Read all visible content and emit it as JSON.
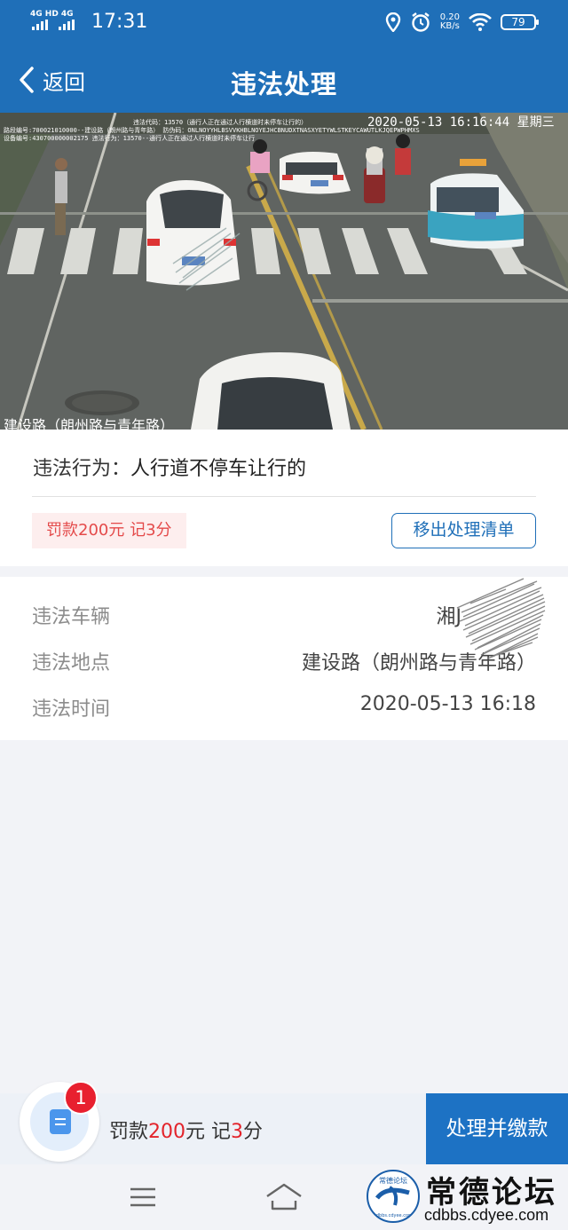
{
  "status_bar": {
    "network_top": "4G HD 4G",
    "time": "17:31",
    "speed_value": "0.20",
    "speed_unit": "KB/s",
    "battery": "79",
    "icons": [
      "signal-icon",
      "location-icon",
      "alarm-icon",
      "wifi-icon",
      "battery-icon"
    ]
  },
  "header": {
    "back_label": "返回",
    "title": "违法处理"
  },
  "photo": {
    "datetime": "2020-05-13 16:16:44 星期三",
    "meta_line1": "违法代码：13570（通行人正在通过人行横道时未停车让行的）",
    "meta_line2": "路段编号:700021010000--建设路（朗州路与青年路）  防伪码：ONLNOYYHLBSVVKHBLNOYEJHCBNUDXTNASXYETYWLSTKEYCAWUTLKJQEPWPHMXS",
    "meta_line3": "设备编号:430700000002175  违法行为：13570--通行人正在通过人行横道时未停车让行",
    "location_overlay": "建设路（朗州路与青年路）"
  },
  "violation": {
    "behavior_label": "违法行为：",
    "behavior_value": "人行道不停车让行的",
    "penalty": "罚款200元 记3分",
    "remove_button": "移出处理清单"
  },
  "details": {
    "vehicle_label": "违法车辆",
    "vehicle_value": "湘J",
    "location_label": "违法地点",
    "location_value": "建设路（朗州路与青年路）",
    "time_label": "违法时间",
    "time_value": "2020-05-13 16:18"
  },
  "footer": {
    "badge_count": "1",
    "fine_prefix": "罚款",
    "fine_amount": "200",
    "fine_unit": "元 记",
    "points": "3",
    "points_unit": "分",
    "pay_button": "处理并缴款"
  },
  "watermark": {
    "circle_text": "常德论坛",
    "circle_url": "cdbbs.cdyee.com",
    "title": "常德论坛",
    "url": "cdbbs.cdyee.com"
  },
  "colors": {
    "primary": "#1f6fb8",
    "pay_button": "#1d72c4",
    "accent_red": "#e3242b",
    "penalty_bg": "#fdeeee"
  }
}
